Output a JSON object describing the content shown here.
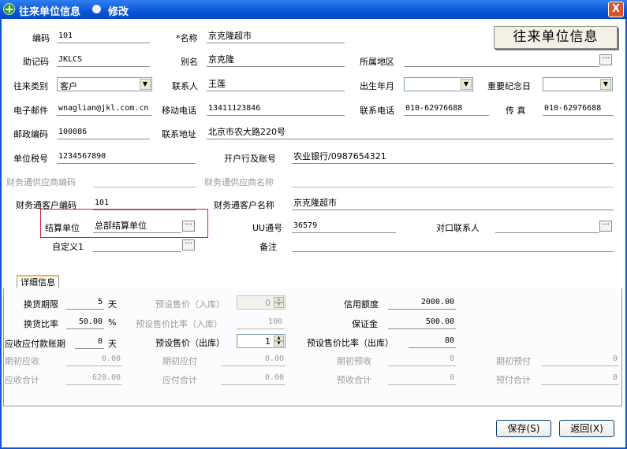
{
  "window": {
    "title": "往来单位信息",
    "mode": "修改",
    "close": "X"
  },
  "stamp": "往来单位信息",
  "form": {
    "code": {
      "label": "编码",
      "value": "101"
    },
    "name": {
      "label": "*名称",
      "value": "京克隆超市"
    },
    "mnemonic": {
      "label": "助记码",
      "value": "JKLCS"
    },
    "alias": {
      "label": "别名",
      "value": "京克隆"
    },
    "region": {
      "label": "所属地区",
      "value": ""
    },
    "type": {
      "label": "往来类别",
      "value": "客户"
    },
    "contact": {
      "label": "联系人",
      "value": "王莲"
    },
    "birth": {
      "label": "出生年月",
      "value": ""
    },
    "anniversary": {
      "label": "重要纪念日",
      "value": ""
    },
    "email": {
      "label": "电子邮件",
      "value": "wnaglian@jkl.com.cn"
    },
    "mobile": {
      "label": "移动电话",
      "value": "13411123846"
    },
    "phone": {
      "label": "联系电话",
      "value": "010-62976688"
    },
    "fax": {
      "label": "传 真",
      "value": "010-62976688"
    },
    "postcode": {
      "label": "邮政编码",
      "value": "100086"
    },
    "address": {
      "label": "联系地址",
      "value": "北京市农大路220号"
    },
    "taxno": {
      "label": "单位税号",
      "value": "1234567890"
    },
    "bank": {
      "label": "开户行及账号",
      "value": "农业银行/0987654321"
    },
    "fin_supplier_code": {
      "label": "财务通供应商编码",
      "value": ""
    },
    "fin_supplier_name": {
      "label": "财务通供应商名称",
      "value": ""
    },
    "fin_customer_code": {
      "label": "财务通客户编码",
      "value": "101"
    },
    "fin_customer_name": {
      "label": "财务通客户名称",
      "value": "京克隆超市"
    },
    "settle_unit": {
      "label": "结算单位",
      "value": "总部结算单位"
    },
    "uu": {
      "label": "UU通号",
      "value": "36579"
    },
    "counterpart": {
      "label": "对口联系人",
      "value": ""
    },
    "custom1": {
      "label": "自定义1",
      "value": ""
    },
    "remark": {
      "label": "备注",
      "value": ""
    }
  },
  "tab": {
    "label": "详细信息"
  },
  "detail": {
    "exchange_days": {
      "label": "换货期限",
      "value": "5",
      "unit": "天"
    },
    "exchange_rate": {
      "label": "换货比率",
      "value": "50.00",
      "unit": "%"
    },
    "ar_ap_days": {
      "label": "应收应付款账期",
      "value": "0",
      "unit": "天"
    },
    "preset_price_in": {
      "label": "预设售价（入库）",
      "value": "0"
    },
    "preset_ratio_in": {
      "label": "预设售价比率（入库）",
      "value": "100"
    },
    "preset_price_out": {
      "label": "预设售价（出库）",
      "value": "1"
    },
    "preset_ratio_out": {
      "label": "预设售价比率（出库）",
      "value": "80"
    },
    "credit": {
      "label": "信用额度",
      "value": "2000.00"
    },
    "deposit": {
      "label": "保证金",
      "value": "500.00"
    },
    "init_receivable": {
      "label": "期初应收",
      "value": "0.00"
    },
    "init_payable": {
      "label": "期初应付",
      "value": "0.00"
    },
    "init_prereceive": {
      "label": "期初预收",
      "value": "0"
    },
    "init_prepay": {
      "label": "期初预付",
      "value": "0"
    },
    "total_receivable": {
      "label": "应收合计",
      "value": "628.00"
    },
    "total_payable": {
      "label": "应付合计",
      "value": "0.00"
    },
    "total_prereceive": {
      "label": "预收合计",
      "value": "0"
    },
    "total_prepay": {
      "label": "预付合计",
      "value": "0"
    }
  },
  "buttons": {
    "save": "保存(S)",
    "back": "返回(X)"
  },
  "ellipsis": "···",
  "colors": {
    "titlebar": "#0a56d8",
    "highlight_box": "#d62424"
  }
}
